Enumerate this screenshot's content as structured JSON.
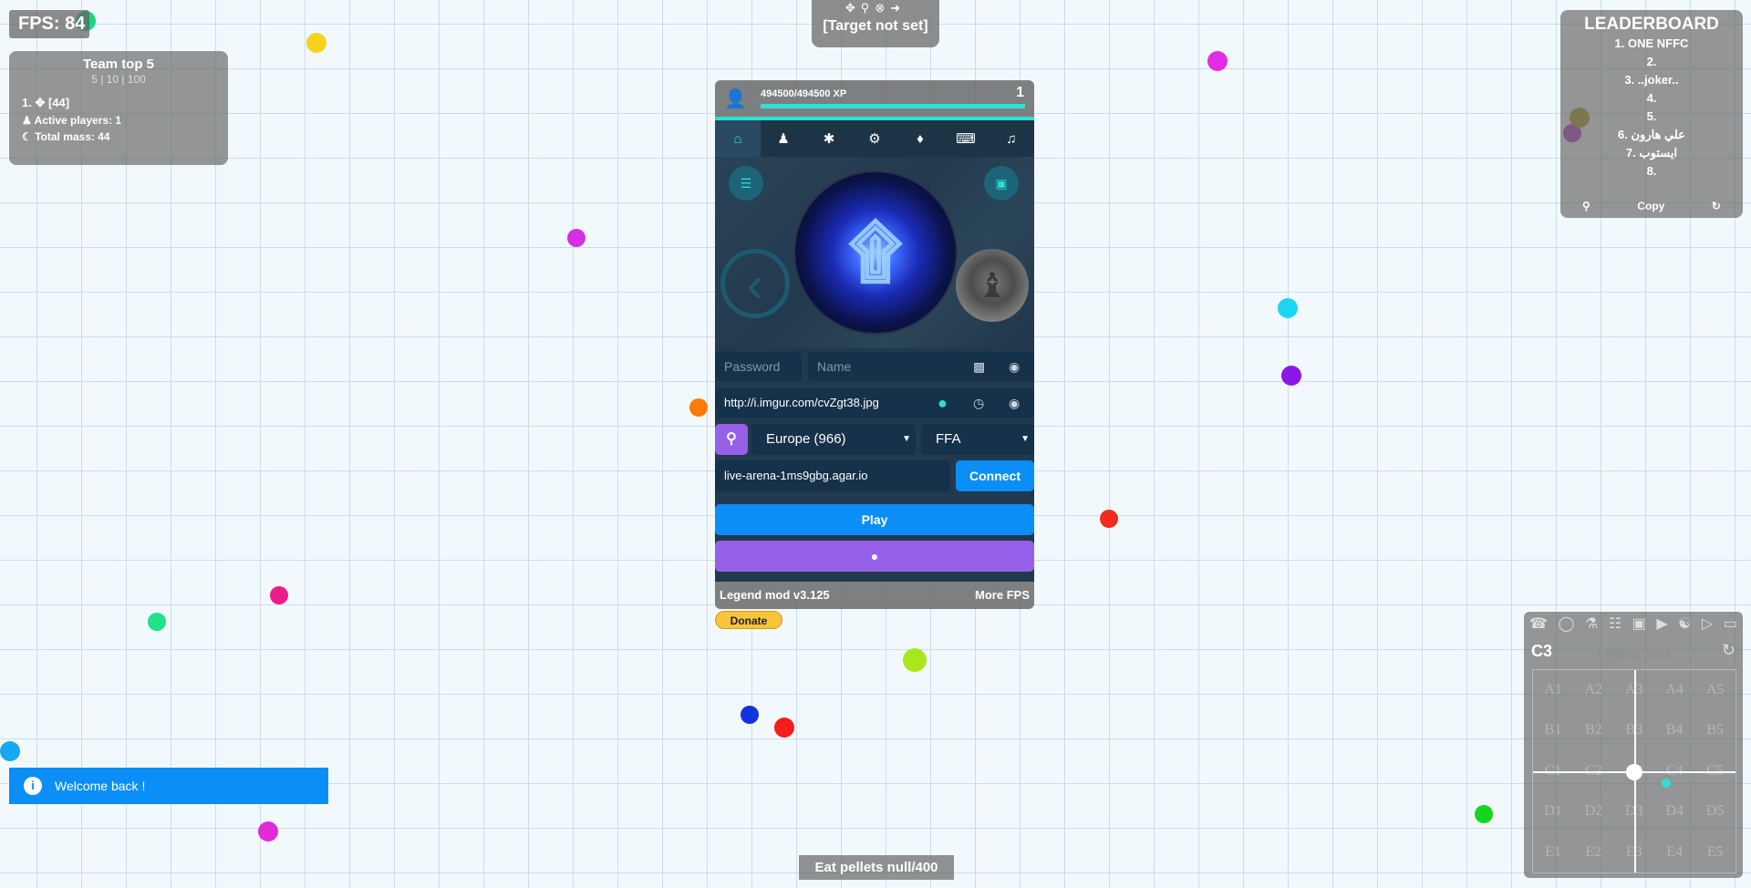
{
  "hud": {
    "fps": "FPS: 84"
  },
  "team": {
    "title": "Team top 5",
    "options": "5 | 10 | 100",
    "members": [
      "1. ✥ [44]"
    ],
    "active_players": "Active players: 1",
    "total_mass": "Total mass: 44"
  },
  "target": {
    "label": "[Target not set]",
    "icons": [
      "crosshair-icon",
      "pin-icon",
      "cancel-icon",
      "arrow-right-icon"
    ]
  },
  "leaderboard": {
    "title": "LEADERBOARD",
    "entries": [
      "1. ONE NFFC",
      "2.",
      "3. ..joker..",
      "4.",
      "5.",
      "6. علي هارون",
      "7. ايستوب",
      "8."
    ],
    "copy_label": "Copy"
  },
  "profile": {
    "xp": "494500/494500 XP",
    "xp_fraction": 1.0,
    "level": "1",
    "tabs": [
      "home",
      "user",
      "puzzle",
      "settings",
      "drop",
      "keyboard",
      "music"
    ],
    "password_placeholder": "Password",
    "name_placeholder": "Name",
    "skin_url": "http://i.imgur.com/cvZgt38.jpg",
    "region": "Europe (966)",
    "mode": "FFA",
    "server": "live-arena-1ms9gbg.agar.io",
    "connect_label": "Connect",
    "play_label": "Play",
    "version": "Legend mod v3.125",
    "more_fps": "More FPS",
    "donate": "Donate"
  },
  "toast": {
    "message": "Welcome back !"
  },
  "task": {
    "text": "Eat pellets null/400"
  },
  "minimap": {
    "sector": "C3",
    "title": "Legend mod",
    "cells": [
      "A1",
      "A2",
      "A3",
      "A4",
      "A5",
      "B1",
      "B2",
      "B3",
      "B4",
      "B5",
      "C1",
      "C2",
      "C3",
      "C4",
      "C5",
      "D1",
      "D2",
      "D3",
      "D4",
      "D5",
      "E1",
      "E2",
      "E3",
      "E4",
      "E5"
    ]
  },
  "colors": {
    "accent": "#2ee0d4",
    "blue": "#0b8ef6",
    "purple": "#9660e8",
    "panel": "#21394d"
  }
}
